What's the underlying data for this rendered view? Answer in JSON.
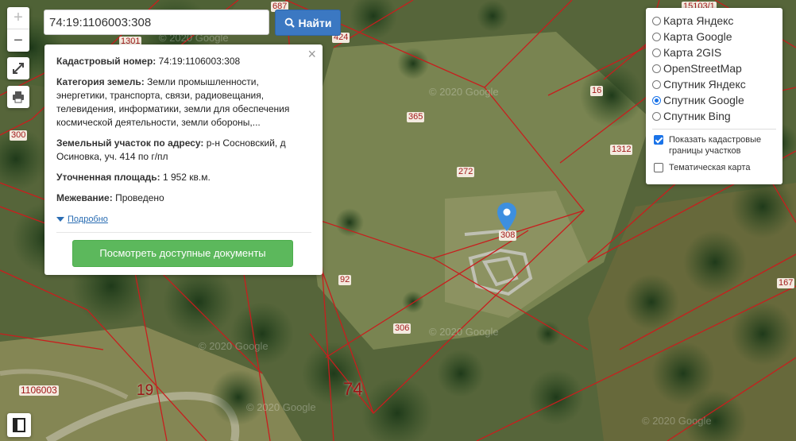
{
  "search": {
    "value": "74:19:1106003:308",
    "button_label": "Найти"
  },
  "map_controls": {
    "zoom_in": "+",
    "zoom_out": "−"
  },
  "info_card": {
    "cad_label": "Кадастровый номер:",
    "cad_value": "74:19:1106003:308",
    "category_label": "Категория земель:",
    "category_value": "Земли промышленности, энергетики, транспорта, связи, радиовещания, телевидения, информатики, земли для обеспечения космической деятельности, земли обороны,...",
    "address_label": "Земельный участок по адресу:",
    "address_value": "р-н Сосновский, д Осиновка, уч. 414 по г/пл",
    "area_label": "Уточненная площадь:",
    "area_value": "1 952 кв.м.",
    "survey_label": "Межевание:",
    "survey_value": "Проведено",
    "more_link": "Подробно",
    "docs_button": "Посмотреть доступные документы",
    "close": "×"
  },
  "layers": {
    "options": [
      {
        "label": "Карта Яндекс",
        "selected": false
      },
      {
        "label": "Карта Google",
        "selected": false
      },
      {
        "label": "Карта 2GIS",
        "selected": false
      },
      {
        "label": "OpenStreetMap",
        "selected": false
      },
      {
        "label": "Спутник Яндекс",
        "selected": false
      },
      {
        "label": "Спутник Google",
        "selected": true
      },
      {
        "label": "Спутник Bing",
        "selected": false
      }
    ],
    "show_cadastral": {
      "label": "Показать кадастровые границы участков",
      "checked": true
    },
    "thematic": {
      "label": "Тематическая карта",
      "checked": false
    }
  },
  "parcel_labels": {
    "p687": "687",
    "p424": "424",
    "p1301": "1301",
    "p300": "300",
    "p365": "365",
    "p16": "16",
    "p1312": "1312",
    "p272": "272",
    "p308": "308",
    "p92": "92",
    "p306": "306",
    "p167": "167",
    "p1106003": "1106003",
    "p19": "19",
    "p74": "74",
    "p15103": "15103/1"
  },
  "watermarks": {
    "wm1": "© 2020 Google",
    "wm2": "© 2020 Google",
    "wm3": "© 2020 Google",
    "wm4": "© 2020 Google",
    "wm5": "© 2020 Google",
    "wm6": "© 2020 Google"
  },
  "colors": {
    "boundary": "#c81e1e",
    "search_button": "#3b78c2",
    "docs_button": "#5cb85c",
    "pin": "#3d8fe0"
  },
  "icons": {
    "search": "search-icon",
    "fullscreen": "fullscreen-icon",
    "print": "print-icon",
    "legend": "legend-icon",
    "pin": "map-pin-icon",
    "close": "close-icon"
  }
}
